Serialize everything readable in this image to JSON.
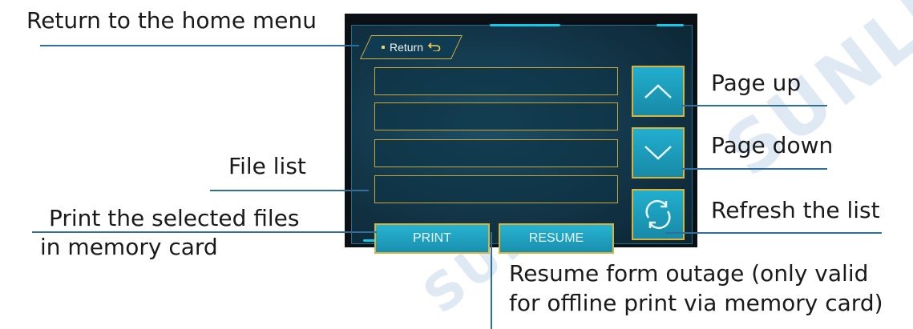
{
  "annotations": {
    "return_home": "Return to the home menu",
    "page_up": "Page up",
    "page_down": "Page down",
    "file_list": "File list",
    "print_line1": "Print the selected files",
    "print_line2": "in memory card",
    "refresh": "Refresh the list",
    "resume_line1": "Resume form outage (only valid",
    "resume_line2": "for offline print via memory card)"
  },
  "screen": {
    "return_label": "Return",
    "file_rows": [
      "",
      "",
      "",
      ""
    ],
    "print_label": "PRINT",
    "resume_label": "RESUME",
    "icons": {
      "return": "return-arrow-icon",
      "page_up": "chevron-up-icon",
      "page_down": "chevron-down-icon",
      "refresh": "refresh-icon"
    }
  },
  "colors": {
    "screen_bg": "#123547",
    "button_fill": "#1e9fbf",
    "button_border": "#d8b43c",
    "accent": "#19c7e6",
    "leader_line": "#2f6f9a"
  }
}
